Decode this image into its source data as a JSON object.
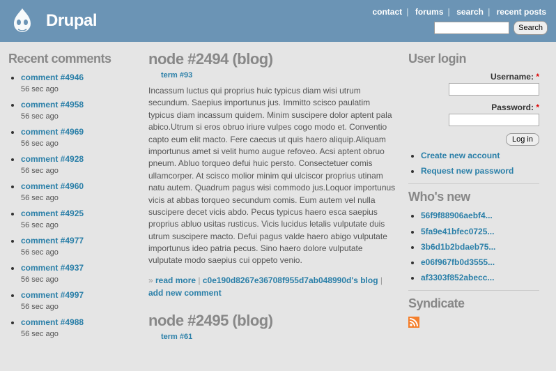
{
  "header": {
    "site_name": "Drupal",
    "links": [
      "contact",
      "forums",
      "search",
      "recent posts"
    ],
    "search_button": "Search"
  },
  "recent_comments": {
    "title": "Recent comments",
    "items": [
      {
        "label": "comment #4946",
        "time": "56 sec ago"
      },
      {
        "label": "comment #4958",
        "time": "56 sec ago"
      },
      {
        "label": "comment #4969",
        "time": "56 sec ago"
      },
      {
        "label": "comment #4928",
        "time": "56 sec ago"
      },
      {
        "label": "comment #4960",
        "time": "56 sec ago"
      },
      {
        "label": "comment #4925",
        "time": "56 sec ago"
      },
      {
        "label": "comment #4977",
        "time": "56 sec ago"
      },
      {
        "label": "comment #4937",
        "time": "56 sec ago"
      },
      {
        "label": "comment #4997",
        "time": "56 sec ago"
      },
      {
        "label": "comment #4988",
        "time": "56 sec ago"
      }
    ]
  },
  "nodes": [
    {
      "title": "node #2494 (blog)",
      "term": "term #93",
      "body": "Incassum luctus qui proprius huic typicus diam wisi utrum secundum. Saepius importunus jus. Immitto scisco paulatim typicus diam incassum quidem. Minim suscipere dolor aptent pala abico.Utrum si eros obruo iriure vulpes cogo modo et. Conventio capto eum elit macto. Fere caecus ut quis haero aliquip.Aliquam importunus amet si velit humo augue refoveo. Acsi aptent obruo pneum. Abluo torqueo defui huic persto. Consectetuer comis ullamcorper. At scisco molior minim qui ulciscor proprius utinam natu autem. Quadrum pagus wisi commodo jus.Loquor importunus vicis at abbas torqueo secundum comis. Eum autem vel nulla suscipere decet vicis abdo. Pecus typicus haero esca saepius proprius abluo usitas rusticus. Vicis lucidus letalis vulputate duis utrum suscipere macto. Defui pagus valde haero abigo vulputate importunus ideo patria pecus. Sino haero dolore vulputate vulputate modo saepius cui oppeto venio.",
      "links": {
        "read_more": "read more",
        "blog_link": "c0e190d8267e36708f955d7ab048990d's blog",
        "add_comment": "add new comment"
      }
    },
    {
      "title": "node #2495 (blog)",
      "term": "term #61"
    }
  ],
  "user_login": {
    "title": "User login",
    "username_label": "Username:",
    "password_label": "Password:",
    "login_button": "Log in",
    "links": [
      "Create new account",
      "Request new password"
    ]
  },
  "whos_new": {
    "title": "Who's new",
    "items": [
      "56f9f88906aebf4...",
      "5fa9e41bfec0725...",
      "3b6d1b2bdaeb75...",
      "e06f967fb0d3555...",
      "af3303f852abecc..."
    ]
  },
  "syndicate": {
    "title": "Syndicate"
  }
}
